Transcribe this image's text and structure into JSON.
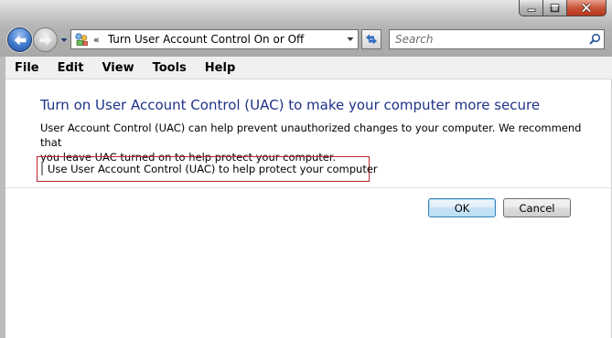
{
  "window": {
    "title_buttons": [
      "minimize-icon",
      "maximize-icon",
      "close-icon"
    ],
    "accent": "#1e3287",
    "highlight_border": "#c0262b"
  },
  "navbar": {
    "back_icon": "back-arrow-icon",
    "forward_icon": "forward-arrow-icon",
    "address": {
      "icon": "control-panel-icon",
      "chevron": "«",
      "path": "Turn User Account Control On or Off"
    },
    "refresh_icon": "refresh-icon",
    "search": {
      "placeholder": "Search",
      "value": ""
    }
  },
  "menu": {
    "items": [
      "File",
      "Edit",
      "View",
      "Tools",
      "Help"
    ]
  },
  "main": {
    "heading": "Turn on User Account Control (UAC) to make your computer more secure",
    "description_line1": "User Account Control (UAC) can help prevent unauthorized changes to your computer.  We recommend that",
    "description_line2": "you leave UAC turned on to help protect your computer.",
    "uac_checkbox": {
      "label": "Use User Account Control (UAC) to help protect your computer",
      "checked": false
    },
    "ok_label": "OK",
    "cancel_label": "Cancel"
  }
}
